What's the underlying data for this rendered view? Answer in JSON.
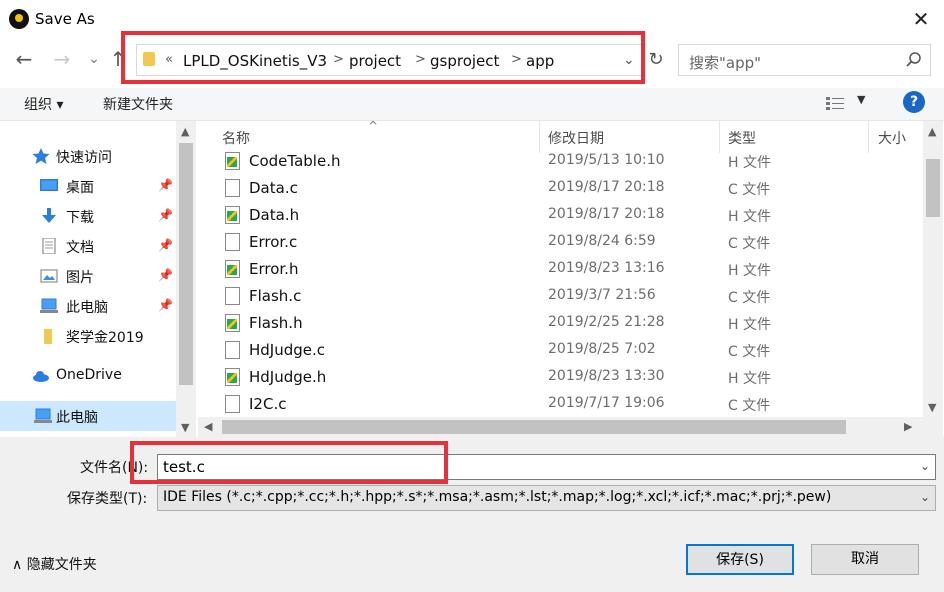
{
  "window": {
    "title": "Save As"
  },
  "nav": {
    "back": "←",
    "forward": "→",
    "recent": "⌄",
    "up": "↑",
    "path": [
      "LPLD_OSKinetis_V3",
      "project",
      "gsproject",
      "app"
    ],
    "overflow": "«",
    "path_dropdown": "⌄",
    "refresh": "↻",
    "search_placeholder": "搜索\"app\""
  },
  "toolbar": {
    "organize": "组织 ▾",
    "new_folder": "新建文件夹",
    "view_dropdown": "▼",
    "help": "?"
  },
  "sidebar": {
    "items": [
      {
        "label": "快速访问",
        "icon": "star-icon",
        "pinned": false
      },
      {
        "label": "桌面",
        "icon": "desktop-icon",
        "pinned": true
      },
      {
        "label": "下载",
        "icon": "download-icon",
        "pinned": true
      },
      {
        "label": "文档",
        "icon": "document-icon",
        "pinned": true
      },
      {
        "label": "图片",
        "icon": "picture-icon",
        "pinned": true
      },
      {
        "label": "此电脑",
        "icon": "computer-icon",
        "pinned": true
      },
      {
        "label": "奖学金2019",
        "icon": "folder-icon",
        "pinned": false
      },
      {
        "label": "OneDrive",
        "icon": "cloud-icon",
        "pinned": false
      },
      {
        "label": "此电脑",
        "icon": "computer-icon",
        "pinned": false,
        "selected": true
      }
    ]
  },
  "filelist": {
    "columns": {
      "name": "名称",
      "date": "修改日期",
      "type": "类型",
      "size": "大小"
    },
    "sort_indicator": "^",
    "rows": [
      {
        "name": "CodeTable.h",
        "date": "2019/5/13 10:10",
        "type": "H 文件",
        "kind": "h"
      },
      {
        "name": "Data.c",
        "date": "2019/8/17 20:18",
        "type": "C 文件",
        "kind": "c"
      },
      {
        "name": "Data.h",
        "date": "2019/8/17 20:18",
        "type": "H 文件",
        "kind": "h"
      },
      {
        "name": "Error.c",
        "date": "2019/8/24 6:59",
        "type": "C 文件",
        "kind": "c"
      },
      {
        "name": "Error.h",
        "date": "2019/8/23 13:16",
        "type": "H 文件",
        "kind": "h"
      },
      {
        "name": "Flash.c",
        "date": "2019/3/7 21:56",
        "type": "C 文件",
        "kind": "c"
      },
      {
        "name": "Flash.h",
        "date": "2019/2/25 21:28",
        "type": "H 文件",
        "kind": "h"
      },
      {
        "name": "HdJudge.c",
        "date": "2019/8/25 7:02",
        "type": "C 文件",
        "kind": "c"
      },
      {
        "name": "HdJudge.h",
        "date": "2019/8/23 13:30",
        "type": "H 文件",
        "kind": "h"
      },
      {
        "name": "I2C.c",
        "date": "2019/7/17 19:06",
        "type": "C 文件",
        "kind": "c"
      }
    ]
  },
  "form": {
    "filename_label": "文件名(N):",
    "filename_value": "test.c",
    "filetype_label": "保存类型(T):",
    "filetype_value": "IDE Files (*.c;*.cpp;*.cc;*.h;*.hpp;*.s*;*.msa;*.asm;*.lst;*.map;*.log;*.xcl;*.icf;*.mac;*.prj;*.pew)",
    "dropdown_glyph": "⌄"
  },
  "footer": {
    "hide_folders": "隐藏文件夹",
    "hide_glyph": "∧",
    "save": "保存(S)",
    "cancel": "取消"
  },
  "colors": {
    "highlight_red": "#e8303a",
    "accent_blue": "#0078d7",
    "nav_selected": "#cce8ff"
  }
}
